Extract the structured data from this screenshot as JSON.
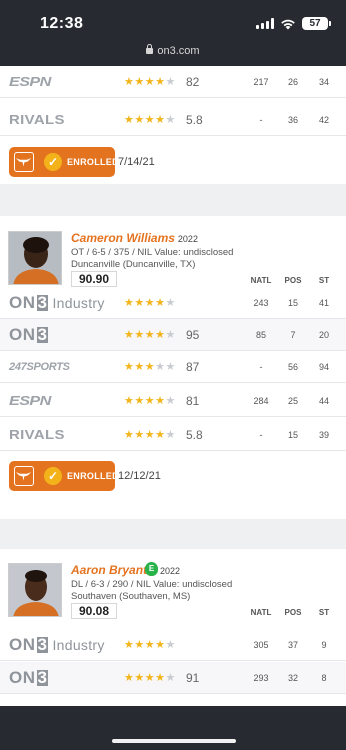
{
  "status_bar": {
    "time": "12:38",
    "battery": "57"
  },
  "browser": {
    "url": "on3.com"
  },
  "prev_player": {
    "ratings": [
      {
        "service": "espn",
        "stars": 4,
        "score": "82",
        "natl": "217",
        "pos": "26",
        "st": "34"
      },
      {
        "service": "rivals",
        "stars": 4,
        "score": "5.8",
        "natl": "-",
        "pos": "36",
        "st": "42"
      }
    ],
    "enrolled": {
      "label": "ENROLLED",
      "date": "7/14/21"
    }
  },
  "players": [
    {
      "name": "Cameron Williams",
      "year": "2022",
      "info": "OT / 6-5 / 375 / NIL Value: undisclosed",
      "hometown": "Duncanville (Duncanville, TX)",
      "rating": "90.90",
      "columns": {
        "natl": "NATL",
        "pos": "POS",
        "st": "ST"
      },
      "industry": {
        "label": "Industry",
        "stars": 4,
        "natl": "243",
        "pos": "15",
        "st": "41"
      },
      "ratings": [
        {
          "service": "on3",
          "stars": 4,
          "score": "95",
          "natl": "85",
          "pos": "7",
          "st": "20"
        },
        {
          "service": "247sports",
          "stars": 3,
          "score": "87",
          "natl": "-",
          "pos": "56",
          "st": "94"
        },
        {
          "service": "espn",
          "stars": 4,
          "score": "81",
          "natl": "284",
          "pos": "25",
          "st": "44"
        },
        {
          "service": "rivals",
          "stars": 4,
          "score": "5.8",
          "natl": "-",
          "pos": "15",
          "st": "39"
        }
      ],
      "enrolled": {
        "label": "ENROLLED",
        "date": "12/12/21"
      }
    },
    {
      "name": "Aaron Bryant",
      "year": "2022",
      "badge": "E",
      "info": "DL / 6-3 / 290 / NIL Value: undisclosed",
      "hometown": "Southaven (Southaven, MS)",
      "rating": "90.08",
      "columns": {
        "natl": "NATL",
        "pos": "POS",
        "st": "ST"
      },
      "industry": {
        "label": "Industry",
        "stars": 4,
        "natl": "305",
        "pos": "37",
        "st": "9"
      },
      "ratings": [
        {
          "service": "on3",
          "stars": 4,
          "score": "91",
          "natl": "293",
          "pos": "32",
          "st": "8"
        }
      ]
    }
  ],
  "logos": {
    "espn": "ESPN",
    "rivals": "RIVALS",
    "s247": "247SPORTS",
    "on3_on": "ON",
    "on3_three": "3"
  },
  "colors": {
    "accent": "#e47320",
    "star": "#f2b51b",
    "badge_green": "#27b24a"
  }
}
